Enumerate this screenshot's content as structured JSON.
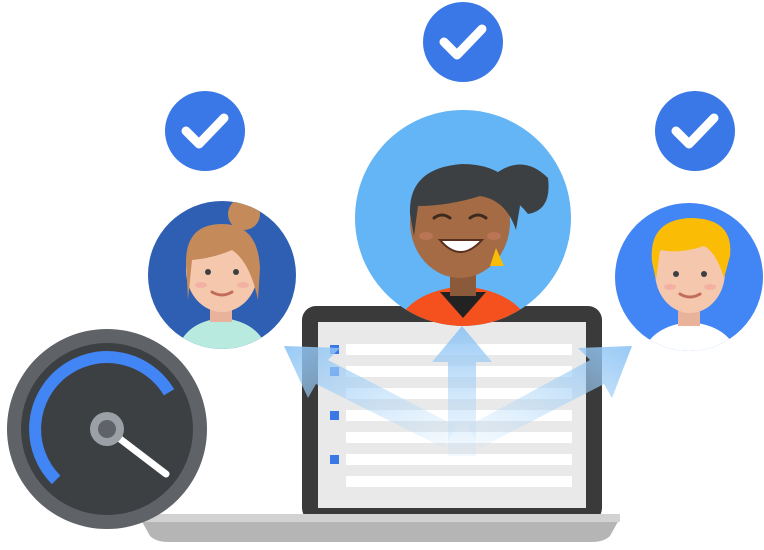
{
  "colors": {
    "check_badge": "#3b78e7",
    "check_mark": "#ffffff",
    "left_avatar_bg": "#2f5fb3",
    "center_avatar_bg": "#64b5f6",
    "right_avatar_bg": "#4285f4",
    "laptop_frame": "#3a3a3a",
    "laptop_screen": "#e9e9e9",
    "list_bullet": "#3b78e7",
    "list_line": "#ffffff",
    "gauge_ring": "#5f6368",
    "gauge_face": "#3c4043",
    "gauge_arc": "#4285f4",
    "arrow_fill": "#9ecbf2"
  },
  "icons": {
    "badges": [
      "check-icon",
      "check-icon",
      "check-icon"
    ],
    "gauge": "speedometer-icon",
    "laptop": "laptop-icon",
    "arrows": [
      "arrow-left-icon",
      "arrow-up-icon",
      "arrow-right-icon"
    ]
  },
  "people": [
    {
      "role": "left-user",
      "hair": "light-brown-bun",
      "shirt": "mint"
    },
    {
      "role": "center-user",
      "hair": "dark-ponytail",
      "shirt": "orange"
    },
    {
      "role": "right-user",
      "hair": "blond",
      "shirt": "white"
    }
  ],
  "gauge": {
    "level": 0.72
  },
  "screen_list": {
    "rows": 7,
    "bulleted_rows": [
      0,
      1,
      3,
      5
    ]
  }
}
